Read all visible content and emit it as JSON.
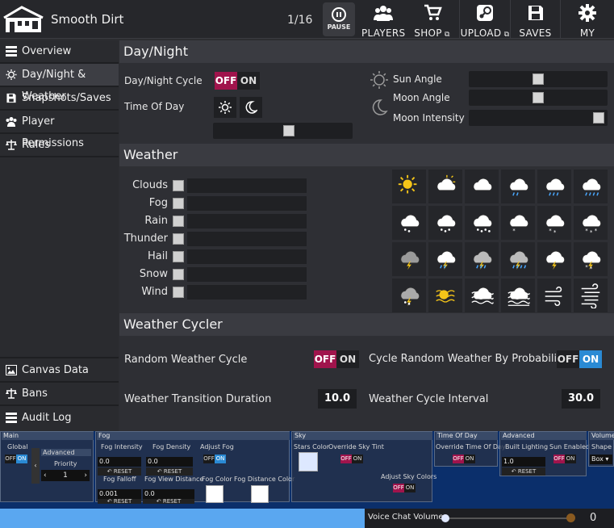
{
  "app": {
    "title": "Smooth Dirt",
    "counter": "1/16"
  },
  "topbar": {
    "pause_label": "PAUSE",
    "buttons": [
      {
        "label": "PLAYERS",
        "icon": "players-icon"
      },
      {
        "label": "SHOP",
        "icon": "shop-icon"
      },
      {
        "label": "UPLOAD",
        "icon": "steam-upload-icon"
      },
      {
        "label": "SAVES",
        "icon": "save-icon"
      },
      {
        "label": "MY CONDO",
        "icon": "gear-icon"
      }
    ]
  },
  "sidebar": {
    "items": [
      {
        "label": "Overview",
        "icon": "list-icon"
      },
      {
        "label": "Day/Night & Weather",
        "icon": "sun-icon"
      },
      {
        "label": "Snapshots/Saves",
        "icon": "save-icon"
      },
      {
        "label": "Player Permissions",
        "icon": "players-icon"
      },
      {
        "label": "Rules",
        "icon": "scales-icon"
      }
    ],
    "bottom_items": [
      {
        "label": "Canvas Data",
        "icon": "image-icon"
      },
      {
        "label": "Bans",
        "icon": "scales-icon"
      },
      {
        "label": "Audit Log",
        "icon": "list-icon"
      }
    ]
  },
  "daynight": {
    "header": "Day/Night",
    "cycle_label": "Day/Night Cycle",
    "off": "OFF",
    "on": "ON",
    "time_of_day_label": "Time Of Day",
    "sun_angle_label": "Sun Angle",
    "moon_angle_label": "Moon Angle",
    "moon_intensity_label": "Moon Intensity",
    "time_of_day_value": 0.55,
    "sun_angle_value": 0.5,
    "moon_angle_value": 0.5,
    "moon_intensity_value": 1.0
  },
  "weather": {
    "header": "Weather",
    "rows": [
      "Clouds",
      "Fog",
      "Rain",
      "Thunder",
      "Hail",
      "Snow",
      "Wind"
    ],
    "presets": [
      "sunny-icon",
      "partly-cloudy-icon",
      "cloudy-icon",
      "light-rain-icon",
      "rain-icon",
      "heavy-rain-icon",
      "hail-icon",
      "light-hail-icon",
      "heavy-hail-icon",
      "light-snow-icon",
      "snow-icon",
      "heavy-snow-icon",
      "thunder-icon",
      "thunder-rain-icon",
      "thunder-heavy-rain-icon",
      "thunder-storm-icon",
      "thunder-cloud-icon",
      "thunder-snow-icon",
      "thunder-hail-icon",
      "fog-sun-icon",
      "fog-cloud-icon",
      "dense-fog-cloud-icon",
      "wind-icon",
      "strong-wind-icon"
    ]
  },
  "cycler": {
    "header": "Weather Cycler",
    "random_label": "Random Weather Cycle",
    "probability_label": "Cycle Random Weather By Probability",
    "transition_label": "Weather Transition Duration",
    "transition_value": "10.0",
    "interval_label": "Weather Cycle Interval",
    "interval_value": "30.0"
  },
  "debug": {
    "main": {
      "title": "Main",
      "global_label": "Global",
      "advanced_label": "Advanced",
      "priority_label": "Priority",
      "priority_value": "1"
    },
    "fog": {
      "title": "Fog",
      "intensity_label": "Fog Intensity",
      "intensity_value": "0.0",
      "density_label": "Fog Density",
      "density_value": "0.0",
      "adjust_label": "Adjust Fog",
      "falloff_label": "Fog Falloff",
      "falloff_value": "0.001",
      "view_distance_label": "Fog View Distance",
      "view_distance_value": "0.0",
      "color_label": "Fog Color",
      "distance_color_label": "Fog Distance Color",
      "reset_label": "RESET"
    },
    "sky": {
      "title": "Sky",
      "stars_label": "Stars Color",
      "override_tint_label": "Override Sky Tint",
      "adjust_colors_label": "Adjust Sky Colors"
    },
    "tod": {
      "title": "Time Of Day",
      "override_label": "Override Time Of Day"
    },
    "advanced": {
      "title": "Advanced",
      "built_lighting_label": "Built Lighting",
      "built_lighting_value": "1.0",
      "sun_enabled_label": "Sun Enabled"
    },
    "volume": {
      "title": "Volume",
      "shape_label": "Shape",
      "shape_value": "Box"
    }
  },
  "voice": {
    "label": "Voice Chat Volume",
    "value": "0"
  }
}
